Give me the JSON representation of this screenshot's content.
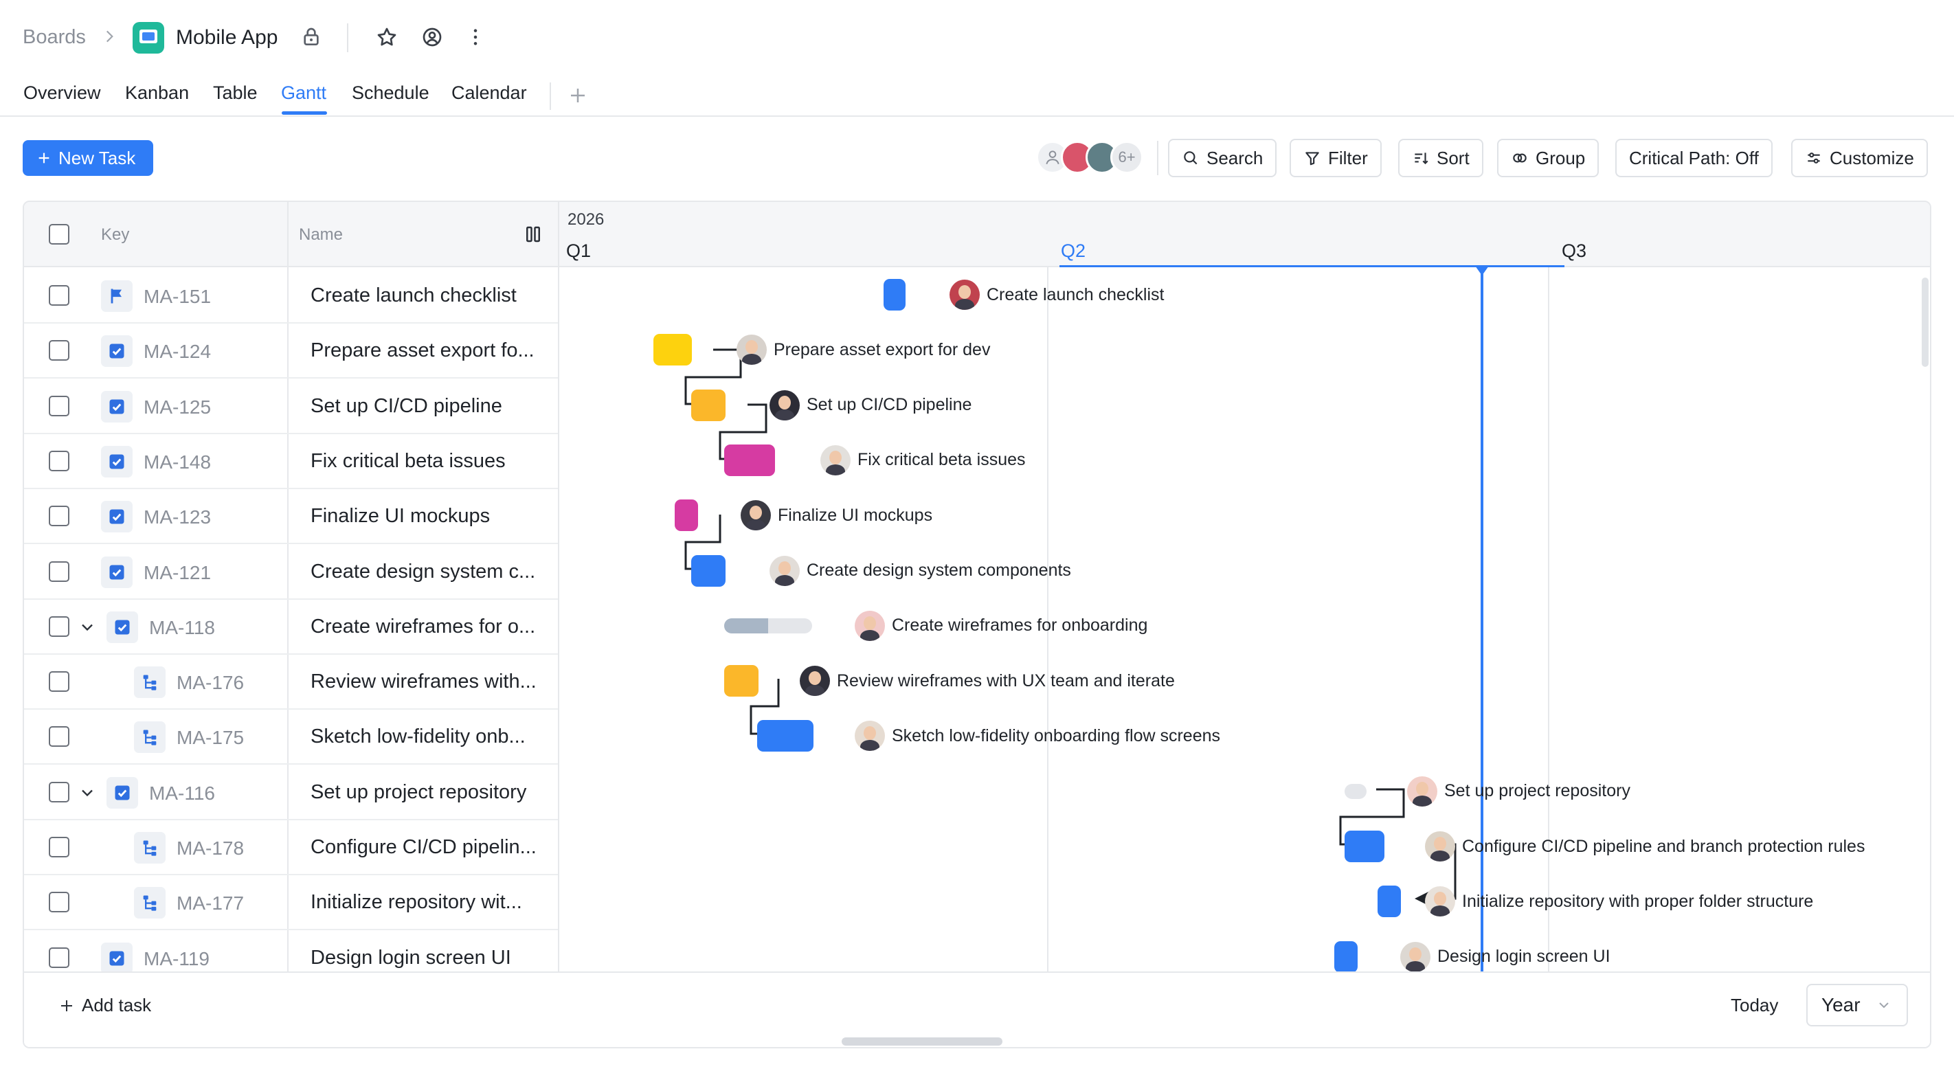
{
  "header": {
    "breadcrumb": "Boards",
    "app_title": "Mobile App"
  },
  "tabs": [
    "Overview",
    "Kanban",
    "Table",
    "Gantt",
    "Schedule",
    "Calendar"
  ],
  "active_tab": "Gantt",
  "toolbar": {
    "new_task": "New Task",
    "avatar_more": "6+",
    "search": "Search",
    "filter": "Filter",
    "sort": "Sort",
    "group": "Group",
    "critical_path": "Critical Path: Off",
    "customize": "Customize"
  },
  "table": {
    "columns": {
      "key": "Key",
      "name": "Name"
    },
    "rows": [
      {
        "key": "MA-151",
        "name": "Create launch checklist",
        "type": "flag-icon"
      },
      {
        "key": "MA-124",
        "name": "Prepare asset export fo...",
        "type": "task-check-icon"
      },
      {
        "key": "MA-125",
        "name": "Set up CI/CD pipeline",
        "type": "task-check-icon"
      },
      {
        "key": "MA-148",
        "name": "Fix critical beta issues",
        "type": "task-check-icon"
      },
      {
        "key": "MA-123",
        "name": "Finalize UI mockups",
        "type": "task-check-icon"
      },
      {
        "key": "MA-121",
        "name": "Create design system c...",
        "type": "task-check-icon"
      },
      {
        "key": "MA-118",
        "name": "Create wireframes for o...",
        "type": "task-check-icon"
      },
      {
        "key": "MA-176",
        "name": "Review wireframes with...",
        "type": "subtask-icon"
      },
      {
        "key": "MA-175",
        "name": "Sketch low-fidelity onb...",
        "type": "subtask-icon"
      },
      {
        "key": "MA-116",
        "name": "Set up project repository",
        "type": "task-check-icon"
      },
      {
        "key": "MA-178",
        "name": "Configure CI/CD pipelin...",
        "type": "subtask-icon"
      },
      {
        "key": "MA-177",
        "name": "Initialize repository wit...",
        "type": "subtask-icon"
      },
      {
        "key": "MA-119",
        "name": "Design login screen UI",
        "type": "task-check-icon"
      }
    ]
  },
  "gantt": {
    "year": "2026",
    "quarters": [
      "Q1",
      "Q2",
      "Q3"
    ],
    "current_quarter": "Q2",
    "labels": [
      "Create launch checklist",
      "Prepare asset export for dev",
      "Set up CI/CD pipeline",
      "Fix critical beta issues",
      "Finalize UI mockups",
      "Create design system components",
      "Create wireframes for onboarding",
      "Review wireframes with UX team and iterate",
      "Sketch low-fidelity onboarding flow screens",
      "Set up project repository",
      "Configure CI/CD pipeline and branch protection rules",
      "Initialize repository with proper folder structure",
      "Design login screen UI"
    ],
    "progress_ma118": 0.5,
    "colors": {
      "blue": "#2f7cf6",
      "yellow": "#fdd20e",
      "orange": "#fbb72a",
      "magenta": "#d63ba2",
      "grey": "#e4e6ea",
      "progress": "#a8b6c6"
    }
  },
  "footer": {
    "add_task": "Add task",
    "today": "Today",
    "zoom": "Year"
  }
}
